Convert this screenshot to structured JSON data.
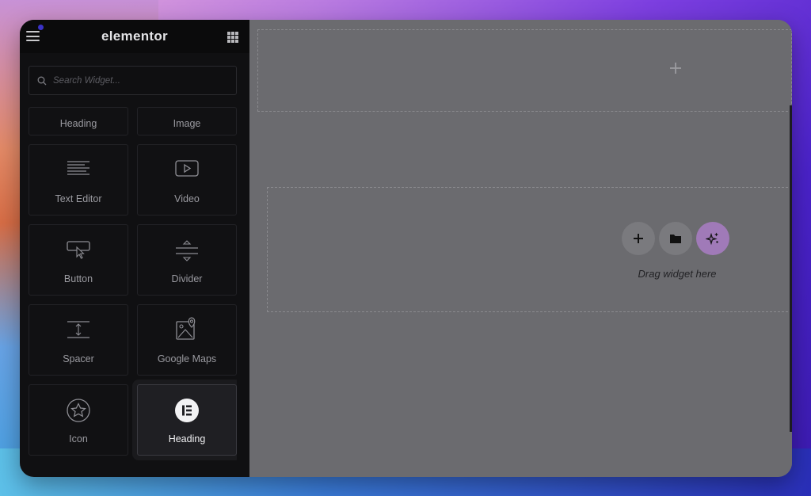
{
  "header": {
    "logo_text": "elementor",
    "menu_icon": "hamburger-icon",
    "apps_icon": "grid-icon"
  },
  "search": {
    "placeholder": "Search Widget..."
  },
  "widgets": [
    {
      "label": "Heading",
      "icon": "none",
      "partial": true
    },
    {
      "label": "Image",
      "icon": "none",
      "partial": true
    },
    {
      "label": "Text Editor",
      "icon": "text-editor-icon"
    },
    {
      "label": "Video",
      "icon": "video-icon"
    },
    {
      "label": "Button",
      "icon": "button-icon"
    },
    {
      "label": "Divider",
      "icon": "divider-icon"
    },
    {
      "label": "Spacer",
      "icon": "spacer-icon"
    },
    {
      "label": "Google Maps",
      "icon": "map-icon"
    },
    {
      "label": "Icon",
      "icon": "star-icon"
    },
    {
      "label": "Heading",
      "icon": "elementor-logo-icon",
      "active": true
    }
  ],
  "canvas": {
    "drag_text": "Drag widget here"
  },
  "colors": {
    "panel_bg": "#101012",
    "canvas_bg": "#6b6b6f",
    "ai_button": "#a07ab8",
    "notification_dot": "#3b33c8"
  }
}
